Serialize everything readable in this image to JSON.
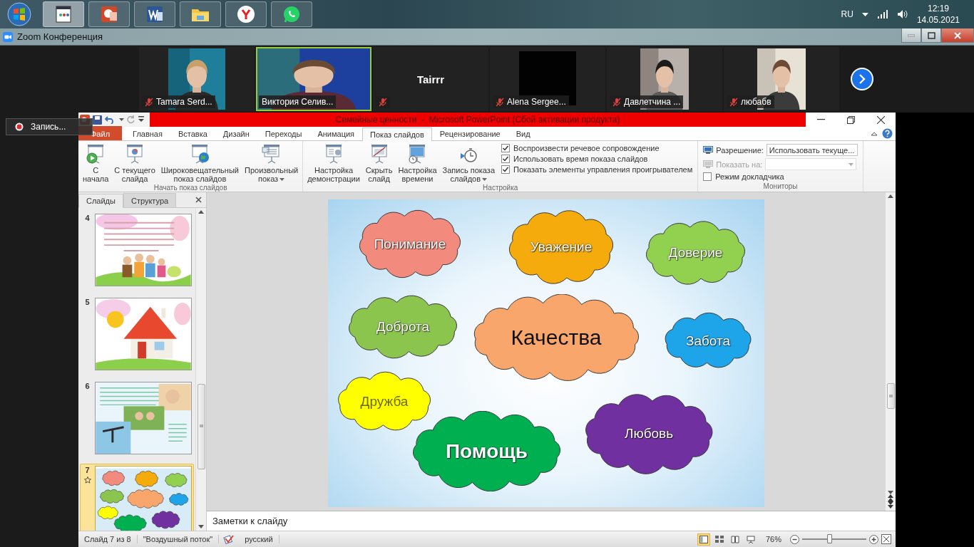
{
  "taskbar": {
    "language": "RU",
    "time": "12:19",
    "date": "14.05.2021"
  },
  "zoom": {
    "title": "Zoom Конференция",
    "recording": "Запись...",
    "participants": [
      {
        "kind": "video",
        "name": "Tamara Serd...",
        "muted": true,
        "speaking": false
      },
      {
        "kind": "video",
        "name": "Виктория Селив...",
        "muted": false,
        "speaking": true
      },
      {
        "kind": "name",
        "name": "Tairrr",
        "muted": true,
        "speaking": false
      },
      {
        "kind": "blank",
        "name": "Alena Sergee...",
        "muted": true,
        "speaking": false
      },
      {
        "kind": "video",
        "name": "Давлетчина ...",
        "muted": true,
        "speaking": false
      },
      {
        "kind": "video",
        "name": "любабв",
        "muted": true,
        "speaking": false
      }
    ]
  },
  "powerpoint": {
    "title": "Семейные ценности  -  Microsoft PowerPoint (Сбой активации продукта)",
    "tabs": [
      {
        "label": "Файл",
        "kind": "file",
        "selected": false
      },
      {
        "label": "Главная",
        "kind": "tab",
        "selected": false
      },
      {
        "label": "Вставка",
        "kind": "tab",
        "selected": false
      },
      {
        "label": "Дизайн",
        "kind": "tab",
        "selected": false
      },
      {
        "label": "Переходы",
        "kind": "tab",
        "selected": false
      },
      {
        "label": "Анимация",
        "kind": "tab",
        "selected": false
      },
      {
        "label": "Показ слайдов",
        "kind": "tab",
        "selected": true
      },
      {
        "label": "Рецензирование",
        "kind": "tab",
        "selected": false
      },
      {
        "label": "Вид",
        "kind": "tab",
        "selected": false
      }
    ],
    "ribbon": {
      "groups": [
        {
          "title": "Начать показ слайдов",
          "buttons": [
            {
              "label": "С\nначала",
              "dropdown": false
            },
            {
              "label": "С текущего\nслайда",
              "dropdown": false
            },
            {
              "label": "Широковещательный\nпоказ слайдов",
              "dropdown": false
            },
            {
              "label": "Произвольный\nпоказ",
              "dropdown": true
            }
          ]
        },
        {
          "title": "Настройка",
          "buttons": [
            {
              "label": "Настройка\nдемонстрации",
              "dropdown": false
            },
            {
              "label": "Скрыть\nслайд",
              "dropdown": false
            },
            {
              "label": "Настройка\nвремени",
              "dropdown": false
            },
            {
              "label": "Запись показа\nслайдов",
              "dropdown": true
            }
          ],
          "checkboxes": [
            {
              "label": "Воспроизвести речевое сопровождение",
              "checked": true
            },
            {
              "label": "Использовать время показа слайдов",
              "checked": true
            },
            {
              "label": "Показать элементы управления проигрывателем",
              "checked": true
            }
          ]
        },
        {
          "title": "Мониторы",
          "fields": [
            {
              "label": "Разрешение:",
              "value": "Использовать текуще...",
              "disabled": false
            },
            {
              "label": "Показать на:",
              "disabled": true
            }
          ],
          "checkboxes": [
            {
              "label": "Режим докладчика",
              "checked": false
            }
          ]
        }
      ]
    },
    "slide_panel": {
      "tabs": [
        {
          "label": "Слайды",
          "selected": true
        },
        {
          "label": "Структура",
          "selected": false
        }
      ],
      "thumbnails": [
        {
          "number": "4",
          "selected": false,
          "animated": false
        },
        {
          "number": "5",
          "selected": false,
          "animated": false
        },
        {
          "number": "6",
          "selected": false,
          "animated": false
        },
        {
          "number": "7",
          "selected": true,
          "animated": true
        }
      ]
    },
    "slide": {
      "clouds": [
        {
          "label": "Понимание",
          "kind": "quality",
          "color": "#f28b7d"
        },
        {
          "label": "Уважение",
          "kind": "quality",
          "color": "#f5ab0c"
        },
        {
          "label": "Доверие",
          "kind": "quality",
          "color": "#92d050"
        },
        {
          "label": "Доброта",
          "kind": "quality",
          "color": "#8cc54e"
        },
        {
          "label": "Качества",
          "kind": "title",
          "color": "#f8a66c"
        },
        {
          "label": "Забота",
          "kind": "quality",
          "color": "#1ea4e9"
        },
        {
          "label": "Дружба",
          "kind": "quality",
          "color": "#ffff00"
        },
        {
          "label": "Помощь",
          "kind": "accent",
          "color": "#00b050"
        },
        {
          "label": "Любовь",
          "kind": "quality",
          "color": "#7030a0"
        }
      ]
    },
    "notes": {
      "placeholder": "Заметки к слайду"
    },
    "status_bar": {
      "slide": "Слайд 7 из 8",
      "theme": "\"Воздушный поток\"",
      "language": "русский",
      "views": [
        {
          "selected": true
        },
        {
          "selected": false
        },
        {
          "selected": false
        },
        {
          "selected": false
        }
      ],
      "zoom": "76%",
      "level": 0.42
    }
  }
}
